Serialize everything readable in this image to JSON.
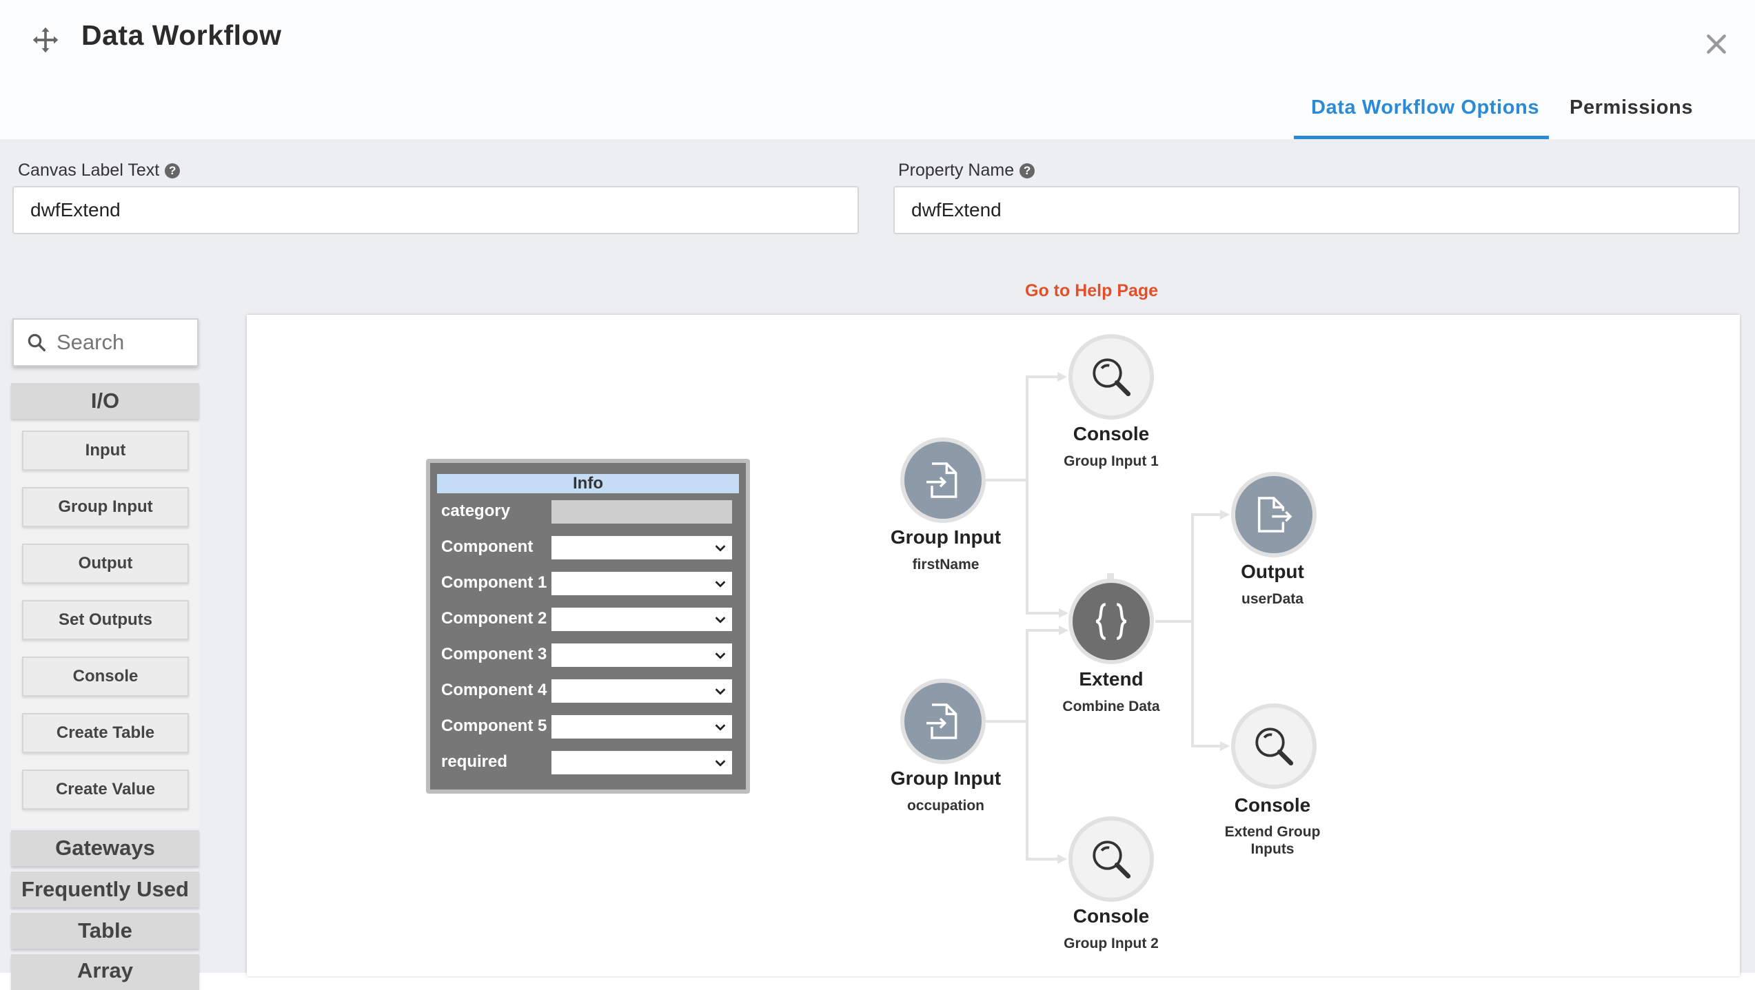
{
  "header": {
    "title": "Data Workflow",
    "tabs": [
      {
        "label": "Data Workflow Options",
        "active": true
      },
      {
        "label": "Permissions",
        "active": false
      }
    ],
    "accent_color": "#2a8ad6"
  },
  "fields": {
    "canvas_label": {
      "label": "Canvas Label Text",
      "value": "dwfExtend"
    },
    "property_name": {
      "label": "Property Name",
      "value": "dwfExtend"
    },
    "help_link": "Go to Help Page"
  },
  "sidebar": {
    "search_placeholder": "Search",
    "sections": [
      "I/O",
      "Gateways",
      "Frequently Used",
      "Table",
      "Array"
    ],
    "io_items": [
      "Input",
      "Group Input",
      "Output",
      "Set Outputs",
      "Console",
      "Create Table",
      "Create Value"
    ]
  },
  "info_box": {
    "title": "Info",
    "rows": [
      "category",
      "Component",
      "Component 1",
      "Component 2",
      "Component 3",
      "Component 4",
      "Component 5",
      "required"
    ]
  },
  "nodes": {
    "group_input_1": {
      "title": "Group Input",
      "sub": "firstName",
      "icon": "file-import-icon"
    },
    "group_input_2": {
      "title": "Group Input",
      "sub": "occupation",
      "icon": "file-import-icon"
    },
    "console_1": {
      "title": "Console",
      "sub": "Group Input 1",
      "icon": "magnifier-icon"
    },
    "console_2": {
      "title": "Console",
      "sub": "Group Input 2",
      "icon": "magnifier-icon"
    },
    "extend": {
      "title": "Extend",
      "sub": "Combine Data",
      "icon": "curly-braces-icon"
    },
    "output": {
      "title": "Output",
      "sub": "userData",
      "icon": "file-export-icon"
    },
    "console_3": {
      "title": "Console",
      "sub": "Extend Group Inputs",
      "icon": "magnifier-icon"
    }
  }
}
